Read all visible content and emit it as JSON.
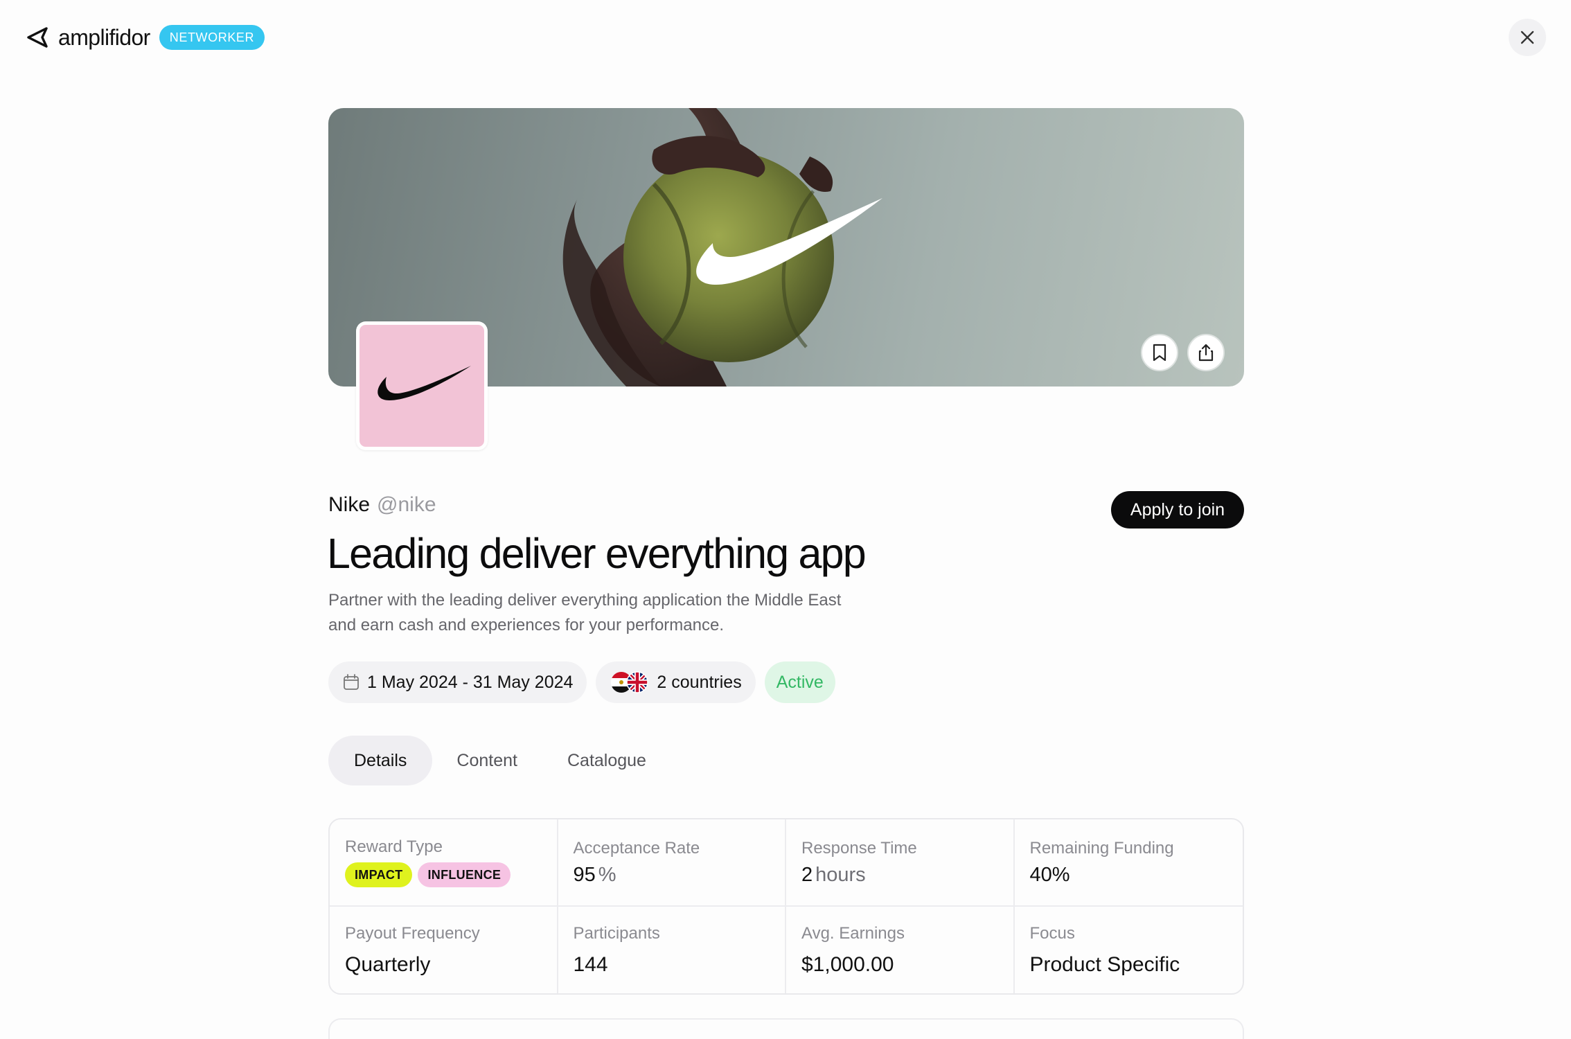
{
  "header": {
    "app_name": "amplifidor",
    "role_badge": "NETWORKER",
    "close_icon": "close-icon"
  },
  "hero": {
    "bookmark_icon": "bookmark-icon",
    "share_icon": "share-icon"
  },
  "brand": {
    "name": "Nike",
    "handle": "@nike",
    "avatar_bg": "#f2c3d6"
  },
  "campaign": {
    "title": "Leading deliver everything app",
    "description": "Partner with the leading deliver everything application the Middle East and earn cash and experiences for your performance.",
    "apply_label": "Apply to join",
    "date_range": "1 May 2024 - 31 May 2024",
    "countries": "2 countries",
    "status": "Active"
  },
  "tabs": [
    {
      "label": "Details",
      "selected": true
    },
    {
      "label": "Content",
      "selected": false
    },
    {
      "label": "Catalogue",
      "selected": false
    }
  ],
  "stats": {
    "reward_type": {
      "label": "Reward Type",
      "tags": [
        "IMPACT",
        "INFLUENCE"
      ]
    },
    "acceptance_rate": {
      "label": "Acceptance Rate",
      "value": "95",
      "unit": "%"
    },
    "response_time": {
      "label": "Response Time",
      "value": "2",
      "unit": "hours"
    },
    "remaining_funding": {
      "label": "Remaining Funding",
      "value": "40%"
    },
    "payout_frequency": {
      "label": "Payout Frequency",
      "value": "Quarterly"
    },
    "participants": {
      "label": "Participants",
      "value": "144"
    },
    "avg_earnings": {
      "label": "Avg. Earnings",
      "value": "$1,000.00"
    },
    "focus": {
      "label": "Focus",
      "value": "Product Specific"
    }
  },
  "colors": {
    "accent_badge": "#35c6f0",
    "status_active": "#33b864",
    "tag_impact": "#dff21e",
    "tag_influence": "#f6c3e3"
  }
}
